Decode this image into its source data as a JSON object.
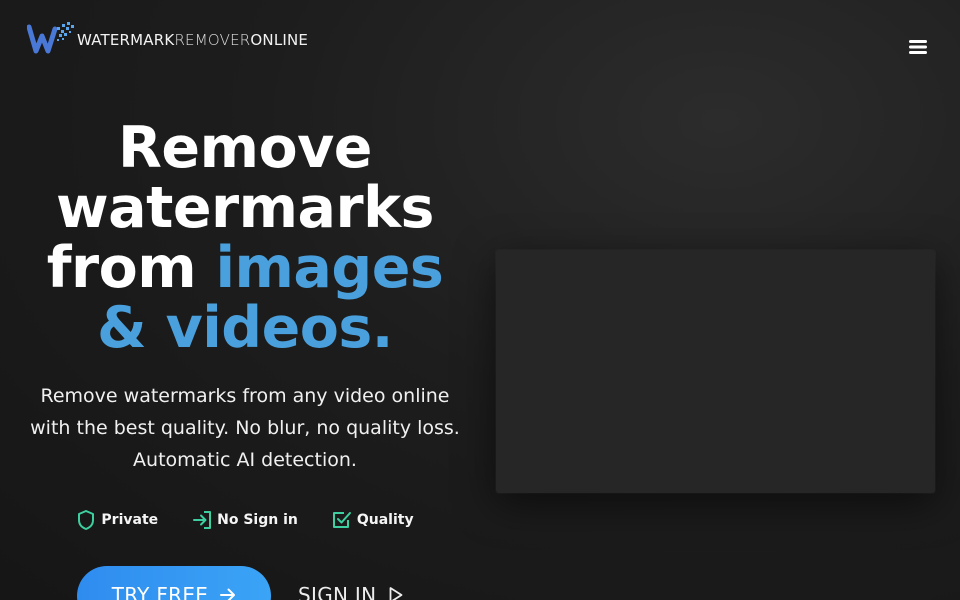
{
  "brand": {
    "name_bold": "WATERMARK",
    "name_light": "REMOVER",
    "name_end": "ONLINE",
    "logo_icon": "w-logo-icon",
    "accent_color": "#4aa0dc"
  },
  "header": {
    "menu_icon": "hamburger-menu-icon"
  },
  "hero": {
    "title_line1": "Remove",
    "title_line2": "watermarks",
    "title_line3_plain": "from ",
    "title_line3_accent": "images",
    "title_line4": "& videos.",
    "description_line1": "Remove watermarks from any video online",
    "description_line2": "with the best quality. No blur, no quality loss.",
    "description_line3": "Automatic AI detection."
  },
  "features": [
    {
      "icon": "shield-icon",
      "label": "Private"
    },
    {
      "icon": "sign-in-arrow-icon",
      "label": "No Sign in"
    },
    {
      "icon": "checkbox-icon",
      "label": "Quality"
    }
  ],
  "cta": {
    "try_label": "TRY FREE",
    "try_icon": "arrow-right-icon",
    "signin_label": "SIGN IN",
    "signin_icon": "play-triangle-icon",
    "button_color": "#3399f2"
  },
  "colors": {
    "feature_icon": "#3ecfa0"
  }
}
